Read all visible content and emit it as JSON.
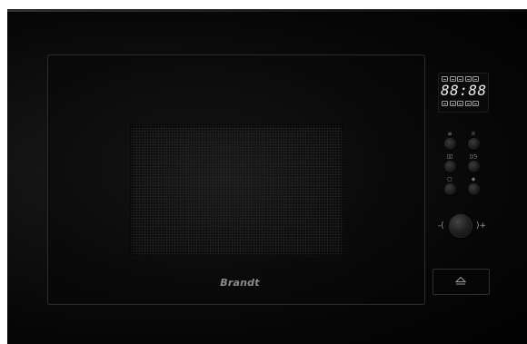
{
  "brand": "Brandt",
  "display": {
    "time": "88:88",
    "top_icons": [
      "grill-icon",
      "microwave-icon",
      "defrost-icon",
      "combi-icon",
      "fan-icon"
    ],
    "bottom_icons": [
      "weight-icon",
      "program-icon",
      "power-icon",
      "auto-icon",
      "lock-icon"
    ]
  },
  "buttons": [
    {
      "icon": "≡",
      "name": "menu-icon"
    },
    {
      "icon": "♕",
      "name": "auto-cook-icon"
    },
    {
      "icon": "▯▯",
      "name": "power-level-icon"
    },
    {
      "icon": "▯◷",
      "name": "timer-icon"
    },
    {
      "icon": "▢",
      "name": "stop-icon"
    },
    {
      "icon": "◈",
      "name": "start-icon"
    }
  ],
  "knob": {
    "minus": "-(",
    "plus": ")+"
  },
  "door_button": {
    "icon": "eject-icon"
  },
  "colors": {
    "body": "#050505",
    "display_text": "#e8e8e8",
    "brand_text": "#8a8a8a"
  }
}
